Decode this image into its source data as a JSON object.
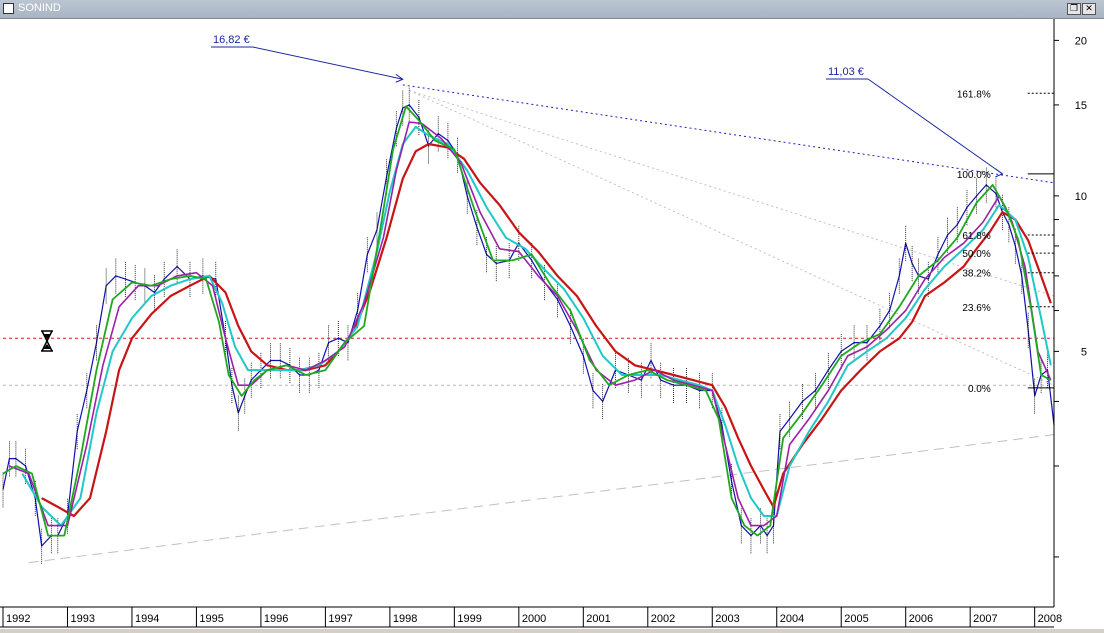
{
  "window": {
    "title": "SONIND",
    "buttons": [
      "restore",
      "close"
    ]
  },
  "colors": {
    "price": "#1010b0",
    "ma_fast": "#1fa81f",
    "ma_mid": "#9d20a8",
    "ma_slow": "#20c8c8",
    "ma_long": "#c81414",
    "support_line": "#c0c0c0",
    "resistance_line": "#2020c0",
    "level_line": "#d02020",
    "fib_line": "#000000",
    "annotation": "#1a2aa0"
  },
  "chart_data": {
    "type": "line",
    "y_scale": "log",
    "ylim": [
      1.6,
      22
    ],
    "y_ticks": [
      5,
      10,
      15,
      20
    ],
    "x_tick_labels": [
      "1992",
      "1993",
      "1994",
      "1995",
      "1996",
      "1997",
      "1998",
      "1999",
      "2000",
      "2001",
      "2002",
      "2003",
      "2004",
      "2005",
      "2006",
      "2007",
      "2008"
    ],
    "xlim": [
      1992.0,
      2008.3
    ],
    "grid": false,
    "legend": "none",
    "series": [
      {
        "role": "price",
        "x": [
          1992.0,
          1992.1,
          1992.2,
          1992.35,
          1992.5,
          1992.6,
          1992.75,
          1992.85,
          1993.0,
          1993.15,
          1993.3,
          1993.45,
          1993.6,
          1993.75,
          1993.9,
          1994.05,
          1994.2,
          1994.35,
          1994.5,
          1994.7,
          1994.9,
          1995.1,
          1995.3,
          1995.45,
          1995.55,
          1995.65,
          1995.75,
          1995.85,
          1996.0,
          1996.15,
          1996.3,
          1996.45,
          1996.6,
          1996.75,
          1996.9,
          1997.05,
          1997.2,
          1997.35,
          1997.5,
          1997.65,
          1997.8,
          1997.95,
          1998.1,
          1998.2,
          1998.3,
          1998.45,
          1998.6,
          1998.75,
          1998.9,
          1999.05,
          1999.2,
          1999.35,
          1999.5,
          1999.65,
          1999.85,
          2000.0,
          2000.2,
          2000.4,
          2000.6,
          2000.8,
          2001.0,
          2001.15,
          2001.3,
          2001.5,
          2001.7,
          2001.9,
          2002.05,
          2002.2,
          2002.4,
          2002.6,
          2002.8,
          2003.0,
          2003.15,
          2003.3,
          2003.45,
          2003.6,
          2003.75,
          2003.85,
          2003.95,
          2004.05,
          2004.2,
          2004.4,
          2004.6,
          2004.8,
          2005.0,
          2005.2,
          2005.4,
          2005.6,
          2005.75,
          2005.9,
          2006.0,
          2006.1,
          2006.2,
          2006.35,
          2006.5,
          2006.65,
          2006.8,
          2006.95,
          2007.1,
          2007.25,
          2007.4,
          2007.5,
          2007.6,
          2007.7,
          2007.8,
          2007.9,
          2008.0,
          2008.1,
          2008.2,
          2008.3
        ],
        "y": [
          2.7,
          3.1,
          3.1,
          3.0,
          2.6,
          2.1,
          2.2,
          2.2,
          2.4,
          3.5,
          4.2,
          5.2,
          6.7,
          7.0,
          6.9,
          6.8,
          6.7,
          6.5,
          6.9,
          7.3,
          6.9,
          7.0,
          6.9,
          5.3,
          4.3,
          3.8,
          4.1,
          4.4,
          4.6,
          4.8,
          4.8,
          4.7,
          4.5,
          4.5,
          4.6,
          5.2,
          5.3,
          5.2,
          6.0,
          7.7,
          8.6,
          10.9,
          13.5,
          14.8,
          15.0,
          14.2,
          12.5,
          13.2,
          12.8,
          12.0,
          10.0,
          8.7,
          7.7,
          7.4,
          7.5,
          8.1,
          7.5,
          6.8,
          6.3,
          5.6,
          4.9,
          4.2,
          4.0,
          4.6,
          4.5,
          4.4,
          4.8,
          4.4,
          4.3,
          4.3,
          4.2,
          4.2,
          3.6,
          2.8,
          2.3,
          2.2,
          2.3,
          2.2,
          2.3,
          3.5,
          3.7,
          4.0,
          4.2,
          4.6,
          5.0,
          5.2,
          5.2,
          5.6,
          6.0,
          7.0,
          8.1,
          7.4,
          7.0,
          6.9,
          7.7,
          8.4,
          8.8,
          9.5,
          10.0,
          10.5,
          10.1,
          9.3,
          8.8,
          8.0,
          7.0,
          5.5,
          4.1,
          4.5,
          4.6,
          3.6
        ]
      },
      {
        "role": "moving-average-long",
        "x": [
          1992.6,
          1992.85,
          1993.1,
          1993.35,
          1993.6,
          1993.8,
          1994.0,
          1994.3,
          1994.6,
          1994.9,
          1995.2,
          1995.45,
          1995.65,
          1995.85,
          1996.1,
          1996.4,
          1996.7,
          1997.0,
          1997.2,
          1997.45,
          1997.7,
          1997.95,
          1998.2,
          1998.4,
          1998.6,
          1998.9,
          1999.15,
          1999.4,
          1999.7,
          2000.0,
          2000.3,
          2000.6,
          2000.9,
          2001.2,
          2001.5,
          2001.8,
          2002.1,
          2002.4,
          2002.7,
          2003.0,
          2003.2,
          2003.4,
          2003.6,
          2003.8,
          2003.95,
          2004.1,
          2004.4,
          2004.7,
          2005.0,
          2005.3,
          2005.6,
          2005.9,
          2006.1,
          2006.3,
          2006.6,
          2006.9,
          2007.1,
          2007.3,
          2007.5,
          2007.7,
          2007.9,
          2008.1,
          2008.25
        ],
        "y": [
          2.6,
          2.5,
          2.4,
          2.6,
          3.5,
          4.6,
          5.3,
          5.9,
          6.4,
          6.7,
          7.0,
          6.5,
          5.6,
          5.0,
          4.7,
          4.6,
          4.6,
          4.7,
          5.0,
          5.5,
          6.6,
          8.3,
          10.8,
          12.2,
          12.6,
          12.4,
          11.8,
          10.6,
          9.6,
          8.5,
          7.8,
          7.0,
          6.4,
          5.6,
          5.0,
          4.7,
          4.6,
          4.5,
          4.4,
          4.3,
          3.9,
          3.4,
          3.0,
          2.7,
          2.5,
          2.9,
          3.3,
          3.7,
          4.2,
          4.6,
          5.0,
          5.3,
          5.7,
          6.4,
          6.8,
          7.3,
          7.9,
          8.5,
          9.3,
          9.0,
          8.2,
          7.0,
          6.2
        ]
      },
      {
        "role": "moving-average-slow",
        "x": [
          1992.3,
          1992.6,
          1992.9,
          1993.2,
          1993.45,
          1993.7,
          1994.0,
          1994.3,
          1994.6,
          1994.9,
          1995.2,
          1995.4,
          1995.6,
          1995.8,
          1996.0,
          1996.3,
          1996.6,
          1996.9,
          1997.2,
          1997.5,
          1997.8,
          1998.0,
          1998.2,
          1998.4,
          1998.6,
          1998.9,
          1999.2,
          1999.5,
          1999.8,
          2000.1,
          2000.4,
          2000.7,
          2001.0,
          2001.3,
          2001.6,
          2001.9,
          2002.2,
          2002.5,
          2002.8,
          2003.0,
          2003.2,
          2003.4,
          2003.6,
          2003.8,
          2004.0,
          2004.2,
          2004.5,
          2004.8,
          2005.1,
          2005.4,
          2005.7,
          2006.0,
          2006.3,
          2006.6,
          2006.9,
          2007.2,
          2007.45,
          2007.7,
          2007.9,
          2008.1,
          2008.25
        ],
        "y": [
          2.9,
          2.5,
          2.3,
          2.6,
          3.8,
          5.0,
          5.8,
          6.4,
          6.7,
          6.9,
          7.0,
          6.2,
          5.1,
          4.6,
          4.6,
          4.6,
          4.6,
          4.7,
          5.0,
          5.6,
          7.8,
          10.2,
          12.6,
          13.6,
          13.1,
          12.6,
          11.2,
          9.5,
          8.3,
          7.9,
          7.2,
          6.6,
          5.8,
          4.9,
          4.5,
          4.5,
          4.5,
          4.4,
          4.3,
          4.2,
          3.6,
          3.0,
          2.6,
          2.4,
          2.4,
          3.0,
          3.5,
          4.0,
          4.7,
          5.0,
          5.3,
          5.8,
          6.6,
          7.3,
          7.9,
          8.6,
          9.6,
          9.0,
          7.6,
          5.8,
          4.7
        ]
      },
      {
        "role": "moving-average-mid",
        "x": [
          1992.1,
          1992.4,
          1992.7,
          1993.0,
          1993.3,
          1993.55,
          1993.8,
          1994.1,
          1994.4,
          1994.7,
          1995.0,
          1995.25,
          1995.45,
          1995.65,
          1995.85,
          1996.1,
          1996.4,
          1996.7,
          1997.0,
          1997.3,
          1997.6,
          1997.9,
          1998.1,
          1998.3,
          1998.5,
          1998.8,
          1999.1,
          1999.4,
          1999.7,
          2000.0,
          2000.3,
          2000.6,
          2000.9,
          2001.2,
          2001.5,
          2001.8,
          2002.1,
          2002.4,
          2002.7,
          2003.0,
          2003.2,
          2003.4,
          2003.6,
          2003.8,
          2004.0,
          2004.2,
          2004.5,
          2004.8,
          2005.1,
          2005.4,
          2005.7,
          2006.0,
          2006.3,
          2006.6,
          2006.9,
          2007.2,
          2007.45,
          2007.65,
          2007.85,
          2008.05,
          2008.25
        ],
        "y": [
          3.0,
          2.9,
          2.3,
          2.3,
          3.3,
          4.7,
          6.1,
          6.7,
          6.7,
          7.0,
          7.1,
          6.7,
          5.3,
          4.3,
          4.3,
          4.6,
          4.7,
          4.6,
          4.8,
          5.1,
          6.2,
          8.3,
          11.2,
          13.9,
          13.8,
          12.9,
          11.6,
          9.3,
          7.9,
          7.8,
          7.0,
          6.4,
          5.5,
          4.6,
          4.3,
          4.4,
          4.6,
          4.4,
          4.3,
          4.2,
          3.3,
          2.6,
          2.3,
          2.3,
          2.4,
          3.3,
          3.7,
          4.2,
          4.9,
          5.1,
          5.5,
          6.0,
          6.9,
          7.6,
          8.1,
          8.9,
          10.0,
          8.9,
          7.3,
          5.0,
          4.4
        ]
      },
      {
        "role": "moving-average-fast",
        "x": [
          1992.0,
          1992.2,
          1992.45,
          1992.7,
          1992.95,
          1993.2,
          1993.45,
          1993.7,
          1994.0,
          1994.3,
          1994.6,
          1994.9,
          1995.15,
          1995.35,
          1995.5,
          1995.7,
          1995.9,
          1996.1,
          1996.4,
          1996.7,
          1997.0,
          1997.3,
          1997.6,
          1997.85,
          1998.05,
          1998.25,
          1998.45,
          1998.7,
          1999.0,
          1999.3,
          1999.6,
          1999.9,
          2000.2,
          2000.5,
          2000.8,
          2001.1,
          2001.4,
          2001.7,
          2002.0,
          2002.3,
          2002.6,
          2002.9,
          2003.1,
          2003.3,
          2003.5,
          2003.7,
          2003.9,
          2004.1,
          2004.4,
          2004.7,
          2005.0,
          2005.3,
          2005.6,
          2005.9,
          2006.2,
          2006.5,
          2006.8,
          2007.1,
          2007.35,
          2007.55,
          2007.75,
          2007.95,
          2008.1,
          2008.25
        ],
        "y": [
          2.9,
          3.0,
          2.9,
          2.2,
          2.2,
          3.1,
          4.6,
          6.3,
          6.8,
          6.7,
          6.9,
          7.0,
          6.9,
          5.7,
          4.5,
          4.1,
          4.4,
          4.6,
          4.7,
          4.5,
          4.6,
          5.2,
          5.6,
          8.6,
          12.3,
          14.9,
          14.0,
          12.8,
          12.3,
          9.5,
          7.5,
          7.5,
          7.7,
          6.7,
          6.0,
          4.8,
          4.3,
          4.5,
          4.6,
          4.4,
          4.3,
          4.2,
          3.7,
          2.6,
          2.3,
          2.2,
          2.3,
          3.4,
          3.8,
          4.3,
          4.9,
          5.2,
          5.4,
          6.1,
          7.0,
          7.5,
          8.3,
          9.7,
          10.5,
          9.5,
          8.2,
          6.0,
          4.5,
          4.4
        ]
      }
    ],
    "annotations": [
      {
        "text": "16,82 €",
        "x": 1998.2,
        "y": 16.82
      },
      {
        "text": "11,03 €",
        "x": 2007.5,
        "y": 11.03
      }
    ],
    "fibonacci": [
      {
        "label": "161.8%",
        "y": 15.8
      },
      {
        "label": "100.0%",
        "y": 11.03
      },
      {
        "label": "61.8%",
        "y": 8.4
      },
      {
        "label": "50.0%",
        "y": 7.75
      },
      {
        "label": "38.2%",
        "y": 7.1
      },
      {
        "label": "23.6%",
        "y": 6.1
      },
      {
        "label": "0.0%",
        "y": 4.25
      }
    ],
    "lines": [
      {
        "role": "horizontal-level",
        "y": 5.3
      },
      {
        "role": "horizontal-level-grey",
        "y": 4.3
      },
      {
        "role": "support-trendline",
        "x": [
          1992.4,
          2008.3
        ],
        "y": [
          1.95,
          3.45
        ]
      },
      {
        "role": "resistance-trendline",
        "x": [
          1998.2,
          2008.3
        ],
        "y": [
          16.4,
          10.6
        ]
      },
      {
        "role": "fan-line",
        "x": [
          1998.3,
          2008.3
        ],
        "y": [
          16.0,
          4.3
        ]
      },
      {
        "role": "fan-line",
        "x": [
          1998.3,
          2008.3
        ],
        "y": [
          16.0,
          6.4
        ]
      }
    ]
  }
}
